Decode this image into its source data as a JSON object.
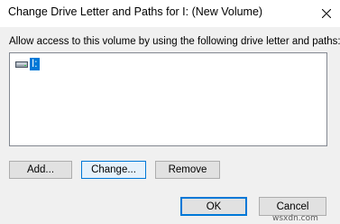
{
  "window": {
    "title": "Change Drive Letter and Paths for I: (New Volume)",
    "close_icon": "close-icon"
  },
  "dialog": {
    "prompt": "Allow access to this volume by using the following drive letter and paths:",
    "list": {
      "items": [
        {
          "label": "I:",
          "icon": "drive-icon",
          "selected": true
        }
      ]
    },
    "buttons": {
      "add": "Add...",
      "change": "Change...",
      "remove": "Remove",
      "ok": "OK",
      "cancel": "Cancel"
    }
  },
  "watermark": "wsxdn.com",
  "colors": {
    "selection": "#0078d7",
    "titlebar_bg": "#ffffff",
    "dialog_bg": "#f0f0f0"
  }
}
